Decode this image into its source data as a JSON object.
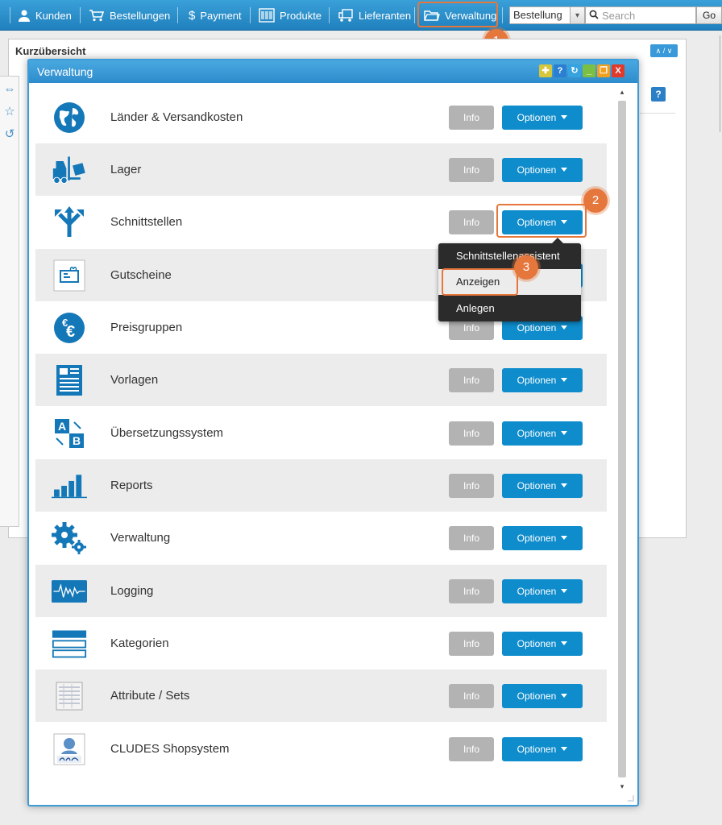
{
  "topnav": {
    "items": [
      {
        "label": "Kunden",
        "icon": "user-icon"
      },
      {
        "label": "Bestellungen",
        "icon": "cart-icon"
      },
      {
        "label": "Payment",
        "icon": "dollar-icon"
      },
      {
        "label": "Produkte",
        "icon": "barcode-icon"
      },
      {
        "label": "Lieferanten",
        "icon": "truck-icon"
      },
      {
        "label": "Verwaltung",
        "icon": "folder-icon"
      }
    ],
    "select_value": "Bestellung",
    "search_placeholder": "Search",
    "go_label": "Go"
  },
  "background_panel": {
    "title": "Kurzübersicht",
    "collapse_label": "∧ / ∨",
    "help_label": "?"
  },
  "modal": {
    "title": "Verwaltung",
    "window_buttons": [
      "✚",
      "?",
      "↻",
      "_",
      "❐",
      "X"
    ],
    "info_label": "Info",
    "options_label": "Optionen",
    "rows": [
      {
        "label": "Länder & Versandkosten",
        "icon": "globe-icon"
      },
      {
        "label": "Lager",
        "icon": "forklift-icon"
      },
      {
        "label": "Schnittstellen",
        "icon": "split-arrows-icon"
      },
      {
        "label": "Gutscheine",
        "icon": "voucher-icon"
      },
      {
        "label": "Preisgruppen",
        "icon": "euro-coins-icon"
      },
      {
        "label": "Vorlagen",
        "icon": "document-template-icon"
      },
      {
        "label": "Übersetzungssystem",
        "icon": "translate-ab-icon"
      },
      {
        "label": "Reports",
        "icon": "bar-chart-icon"
      },
      {
        "label": "Verwaltung",
        "icon": "gears-icon"
      },
      {
        "label": "Logging",
        "icon": "pulse-icon"
      },
      {
        "label": "Kategorien",
        "icon": "categories-icon"
      },
      {
        "label": "Attribute / Sets",
        "icon": "attribute-sheet-icon"
      },
      {
        "label": "CLUDES Shopsystem",
        "icon": "cludes-logo-icon"
      }
    ]
  },
  "dropdown": {
    "items": [
      {
        "label": "Schnittstellenassistent"
      },
      {
        "label": "Anzeigen"
      },
      {
        "label": "Anlegen"
      }
    ]
  },
  "callouts": [
    "1",
    "2",
    "3"
  ],
  "colors": {
    "nav_blue": "#2a8fcf",
    "button_blue": "#0e8ccc",
    "info_gray": "#b3b3b3",
    "callout_orange": "#e5773d"
  }
}
